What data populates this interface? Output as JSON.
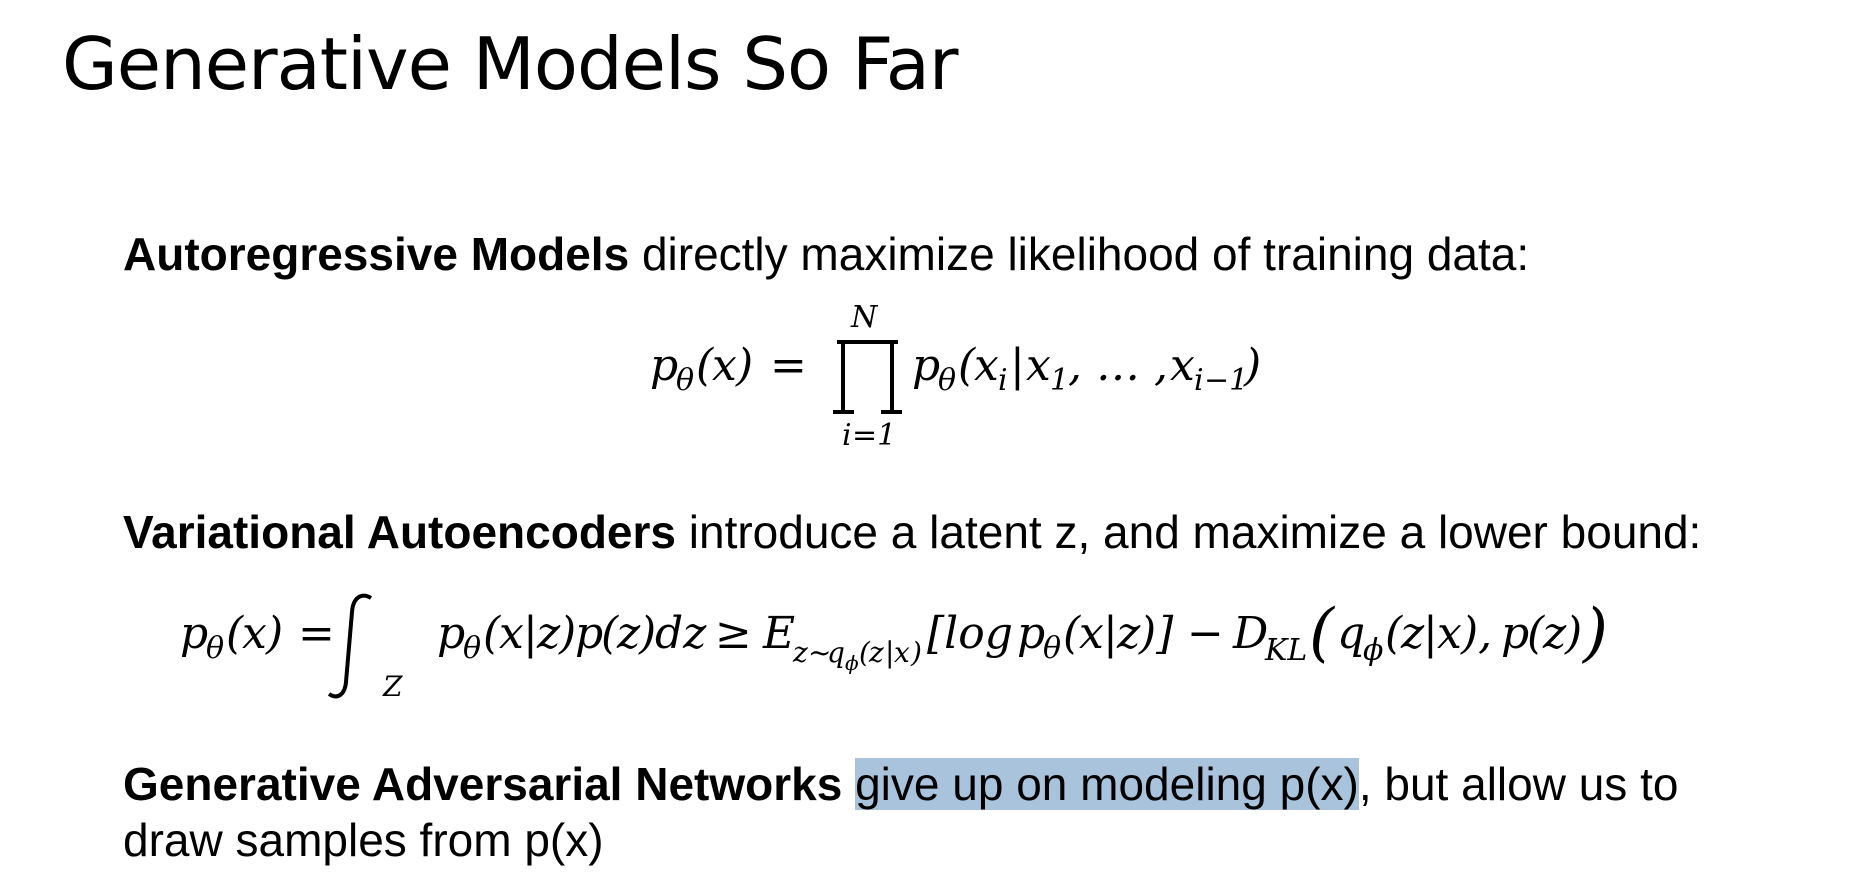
{
  "slide": {
    "title": "Generative Models So Far"
  },
  "autoregressive": {
    "heading": "Autoregressive Models",
    "text": " directly maximize likelihood of training data:"
  },
  "vae": {
    "heading": "Variational Autoencoders",
    "text": " introduce a latent z, and maximize a lower bound:"
  },
  "gan": {
    "heading": "Generative Adversarial Networks",
    "highlighted": "give up on modeling p(x)",
    "text_line1": ", but allow us to",
    "text_line2": "draw samples from p(x)"
  },
  "colors": {
    "highlight": "#a9c3dc",
    "text": "#000000"
  }
}
